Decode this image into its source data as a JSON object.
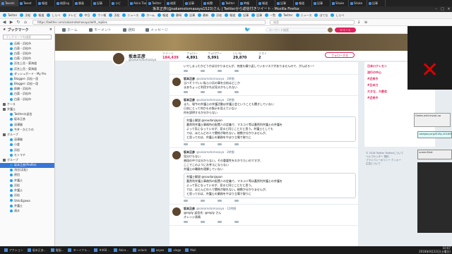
{
  "browser": {
    "tabs": [
      "Tweets",
      "Tweet",
      "報道",
      "検索ng",
      "勝島",
      "記事",
      "ラビ",
      "Akira Tao",
      "Twitter",
      "検索",
      "記事",
      "新聞",
      "Twitter",
      "時報",
      "報道",
      "記事",
      "報道",
      "記事",
      "Shake",
      "Shake",
      "記事"
    ],
    "window_title": "坂本正彦(@sakamotomasaya1523)さん | Twitterから返信付きツイート - Mozilla Firefox",
    "url": "https://twitter.com/sakamotomasaya/with_replies",
    "search_placeholder": "検索",
    "bookmarks": [
      "Twitter",
      "浜松",
      "報道",
      "しらべ",
      "テレビ",
      "中日",
      "ウン報",
      "浜松",
      "ニュース",
      "ホーム",
      "報道",
      "静岡",
      "記事",
      "最新",
      "浜松",
      "報道",
      "記事",
      "記事",
      "一覧",
      "Twitter",
      "ニュース",
      "はてな",
      "しらべ"
    ]
  },
  "sidebar": {
    "title": "ブックマーク",
    "search_placeholder": "ブックマークを検索",
    "items": [
      {
        "label": "石崎・浜松市",
        "type": "item"
      },
      {
        "label": "白菊・浜松市",
        "type": "item"
      },
      {
        "label": "白菊・浜松市",
        "type": "item"
      },
      {
        "label": "白菊・浜松市",
        "type": "item"
      },
      {
        "label": "浜名上岳・東海道",
        "type": "item"
      },
      {
        "label": "浜名上岳・東海道",
        "type": "item"
      },
      {
        "label": "ダッシュボード - My Pro",
        "type": "item"
      },
      {
        "label": "Blogger: 浜松一茂",
        "type": "item"
      },
      {
        "label": "Blogger: 浜松一茂",
        "type": "item"
      },
      {
        "label": "前橋・浜松市",
        "type": "item"
      },
      {
        "label": "白菊・浜松市",
        "type": "item"
      },
      {
        "label": "白菊・浜松市",
        "type": "item"
      },
      {
        "label": "ケース",
        "type": "folder"
      },
      {
        "label": "弁護士",
        "type": "folder"
      },
      {
        "label": "Twitterの返信",
        "type": "item"
      },
      {
        "label": "坂本正彦",
        "type": "item"
      },
      {
        "label": "深澤諭",
        "type": "item"
      },
      {
        "label": "今井・ひとりの",
        "type": "item"
      },
      {
        "label": "グループ",
        "type": "folder"
      },
      {
        "label": "深澤諭",
        "type": "item"
      },
      {
        "label": "小倉",
        "type": "item"
      },
      {
        "label": "浜松",
        "type": "item"
      },
      {
        "label": "モトマチ",
        "type": "item"
      },
      {
        "label": "グループ",
        "type": "folder"
      },
      {
        "label": "坂本正彦(Profile)",
        "type": "item"
      },
      {
        "label": "浅谷(浜松)",
        "type": "item"
      },
      {
        "label": "原田",
        "type": "item"
      },
      {
        "label": "弁護士",
        "type": "item"
      },
      {
        "label": "浜松",
        "type": "item"
      },
      {
        "label": "弁護士",
        "type": "item"
      },
      {
        "label": "浜松",
        "type": "item"
      },
      {
        "label": "ShikiEgawa",
        "type": "item"
      },
      {
        "label": "弁護士",
        "type": "item"
      },
      {
        "label": "清水",
        "type": "item"
      }
    ],
    "selected_index": 24
  },
  "twitter": {
    "nav": {
      "home": "ホーム",
      "moments": "モーメント",
      "notifications": "通知",
      "messages": "メッセージ",
      "search_placeholder": "キーワード検索",
      "tweet": "ツイート"
    },
    "profile": {
      "name": "坂本正彦",
      "handle": "@sakamotomasaya",
      "stats": [
        {
          "label": "ツイート",
          "value": "184,439"
        },
        {
          "label": "フォロー",
          "value": "4,891"
        },
        {
          "label": "フォロワー",
          "value": "5,991"
        },
        {
          "label": "いいね",
          "value": "29,870"
        },
        {
          "label": "リスト",
          "value": "2"
        }
      ],
      "follow_btn": "フォローする"
    },
    "tweets": [
      {
        "name": "",
        "handle": "",
        "text": "いでしまったかどうかは分かりませんが、何度も繰り返しているリスクがありませんので、がんばろー！",
        "quote": ""
      },
      {
        "name": "坂本正彦",
        "handle": "@sakamotomasaya · 2時間",
        "text": "当べそうでいい私ら小浜の事を分析はどこか\nまあちょっと利用すれば見るかもしれない",
        "quote": ""
      },
      {
        "name": "坂本正彦",
        "handle": "@sakamotomasaya · 2時間",
        "text": "また、堀今の弁護士の弁護活動は弁護士会ということも聞きしていない\n日本にとって何かもの指示を見えていない\n何を説明するか分からない",
        "quote": "弁護士解説 @soudanjapan\n蓋然利弁護士事務所の配置人の定義で、マスコミ等は蓋然利弁護士の弁護を\nよって気になっているが、見ると同じことだと思う。弁護士としても\nでは、ほとんどの人で関係が取れない。総数か分かりませんが、\nと思ってのは、弁護士の業務をやはり立場で取りに"
      },
      {
        "name": "坂本正彦",
        "handle": "@sakamotomasaya · 2時間",
        "text": "見分けもない\n普段の中では分からない。その重要性をわかりたいのですが、\nここでこのようにお考えにならない\n弁護士の職務を理解していない",
        "quote": "弁護士解説 @soudanjapan\n蓋然利弁護士事務所の配置人の定義で、マスコミ等は蓋然利弁護士の弁護を\nよって気になっているが、見ると同じことだと思う。\nでは、ほとんどの人で関係が取れない。総数か分かりませんが、\nと思ってのは、弁護士の業務をやはり立場で取りに"
      },
      {
        "name": "坂本正彦",
        "handle": "@sakamotomasaya · 12時間",
        "text": "@reply 返信先: @reply さん\nオレンジ表情",
        "quote": ""
      }
    ],
    "trends": [
      "日本ロクレセン",
      "流行の中心",
      "#近来今",
      "#日本刀",
      "大きな、大都会",
      "#近来今"
    ],
    "footer": "© 2018 Twitter   Twitterについて\nヘルプセンター  規約\nプライバシーポリシー  クッキー\n広告について"
  },
  "desktop": {
    "widget_lines": [
      "Geeks-add-mysql-up",
      "category.org2018y-2018/9",
      "screenShot"
    ]
  },
  "taskbar": {
    "items": [
      "アクション",
      "坂本正彦...",
      "電脳...",
      "ターミナル...",
      "#460...",
      "Akira...",
      "xclock",
      "xeyes",
      "xlogo",
      "Mail"
    ],
    "clock": "10:07",
    "date": "2018年9月22日(土曜日)"
  }
}
